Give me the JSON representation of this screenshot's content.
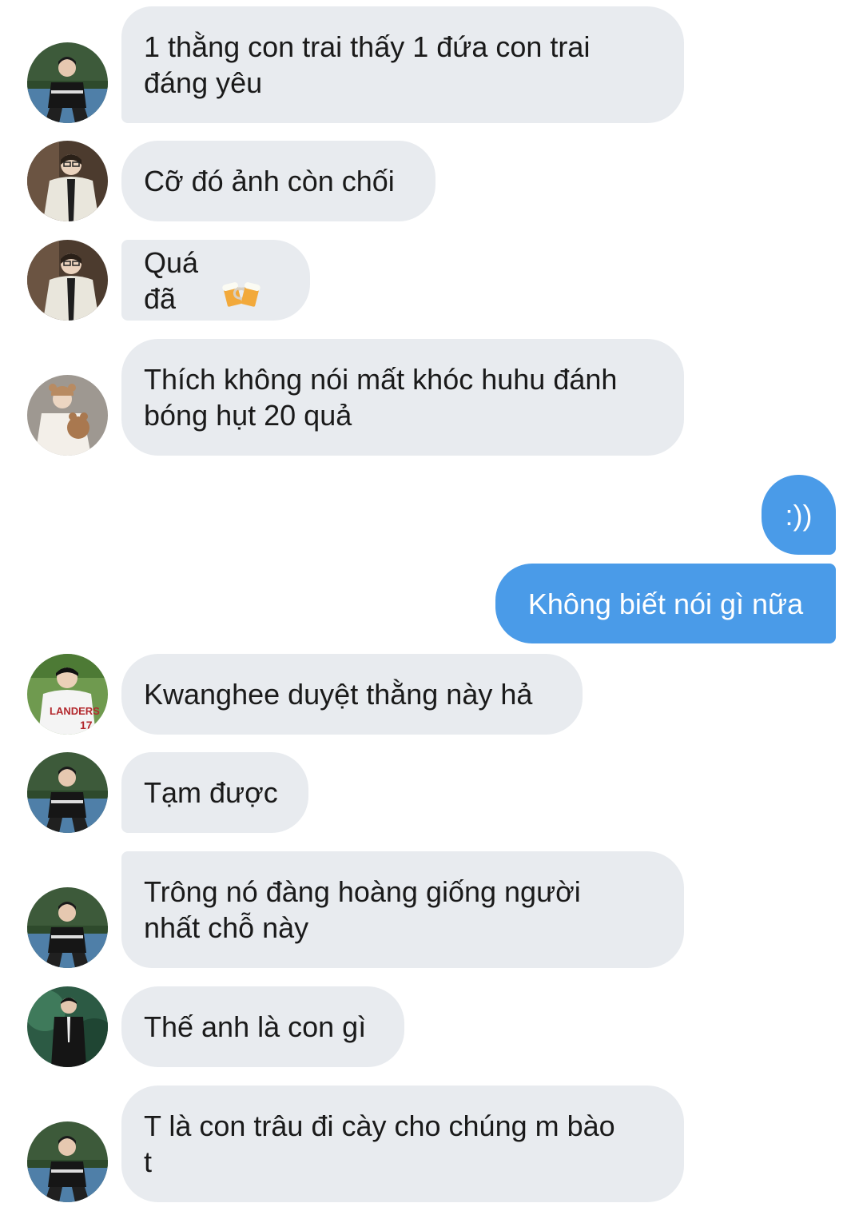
{
  "messages": [
    {
      "id": "m1",
      "side": "in",
      "avatar": "user-a",
      "text": "1 thằng con trai thấy 1 đứa con trai\nđáng yêu"
    },
    {
      "id": "m2",
      "side": "in",
      "avatar": "user-b",
      "text": "Cỡ đó ảnh còn chối"
    },
    {
      "id": "m3",
      "side": "in",
      "avatar": "user-b",
      "text": "Quá đã",
      "emoji": "beer-mugs-icon"
    },
    {
      "id": "m4",
      "side": "in",
      "avatar": "user-c",
      "text": "Thích không nói mất khóc huhu đánh\nbóng hụt 20 quả"
    },
    {
      "id": "m5",
      "side": "out",
      "text": ":))"
    },
    {
      "id": "m6",
      "side": "out",
      "text": "Không biết nói gì nữa"
    },
    {
      "id": "m7",
      "side": "in",
      "avatar": "user-d",
      "text": "Kwanghee duyệt thằng này hả"
    },
    {
      "id": "m8",
      "side": "in",
      "avatar": "user-a",
      "text": "Tạm được"
    },
    {
      "id": "m9",
      "side": "in",
      "avatar": "user-a",
      "text": "Trông nó đàng hoàng giống người\nnhất chỗ này"
    },
    {
      "id": "m10",
      "side": "in",
      "avatar": "user-e",
      "text": "Thế anh là con gì"
    },
    {
      "id": "m11",
      "side": "in",
      "avatar": "user-a",
      "text": "T là con trâu đi cày cho chúng m bào\nt"
    }
  ],
  "colors": {
    "incoming_bubble": "#e8ebef",
    "outgoing_bubble": "#4a9be8",
    "incoming_text": "#1a1a1a",
    "outgoing_text": "#ffffff"
  }
}
